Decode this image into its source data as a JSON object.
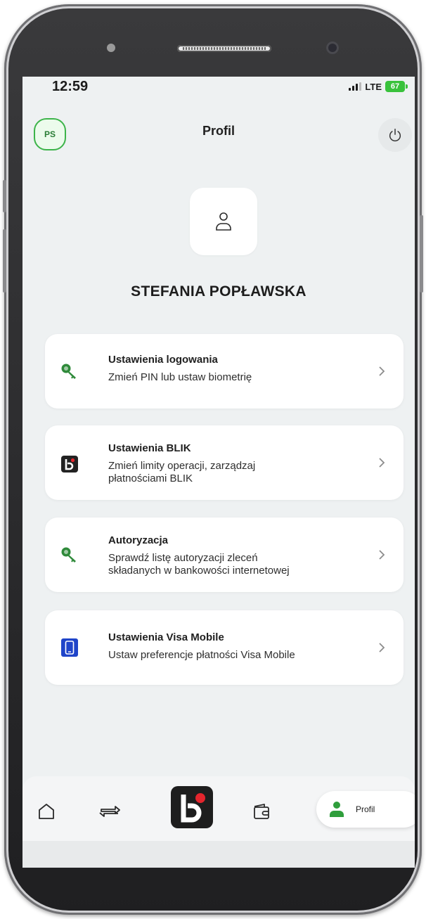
{
  "status_bar": {
    "time": "12:59",
    "network": "LTE",
    "battery": "67"
  },
  "header": {
    "avatar_initials": "PS",
    "title": "Profil",
    "power_icon": "power-icon"
  },
  "profile": {
    "icon": "user-icon",
    "name": "STEFANIA POPŁAWSKA"
  },
  "menu": [
    {
      "title": "Ustawienia logowania",
      "subtitle": "Zmień PIN lub ustaw biometrię",
      "icon": "key-icon"
    },
    {
      "title": "Ustawienia BLIK",
      "subtitle_lines": [
        "Zmień limity operacji, zarządzaj",
        "płatnościami BLIK"
      ],
      "icon": "blik-icon"
    },
    {
      "title": "Autoryzacja",
      "subtitle_lines": [
        "Sprawdź listę autoryzacji zleceń",
        "składanych w bankowości internetowej"
      ],
      "icon": "key-icon"
    },
    {
      "title": "Ustawienia Visa Mobile",
      "subtitle": "Ustaw preferencje płatności Visa Mobile",
      "icon": "phone-icon"
    }
  ],
  "bottom_nav": {
    "items": [
      {
        "icon": "home-icon"
      },
      {
        "icon": "transfer-icon"
      },
      {
        "icon": "blik-icon"
      },
      {
        "icon": "wallet-icon"
      },
      {
        "icon": "profile-icon",
        "label": "Profil",
        "active": true
      }
    ]
  },
  "colors": {
    "accent_green": "#3db44a",
    "blik_red": "#e4252d",
    "visa_blue": "#1f44c9",
    "screen_bg": "#eef1f2"
  }
}
